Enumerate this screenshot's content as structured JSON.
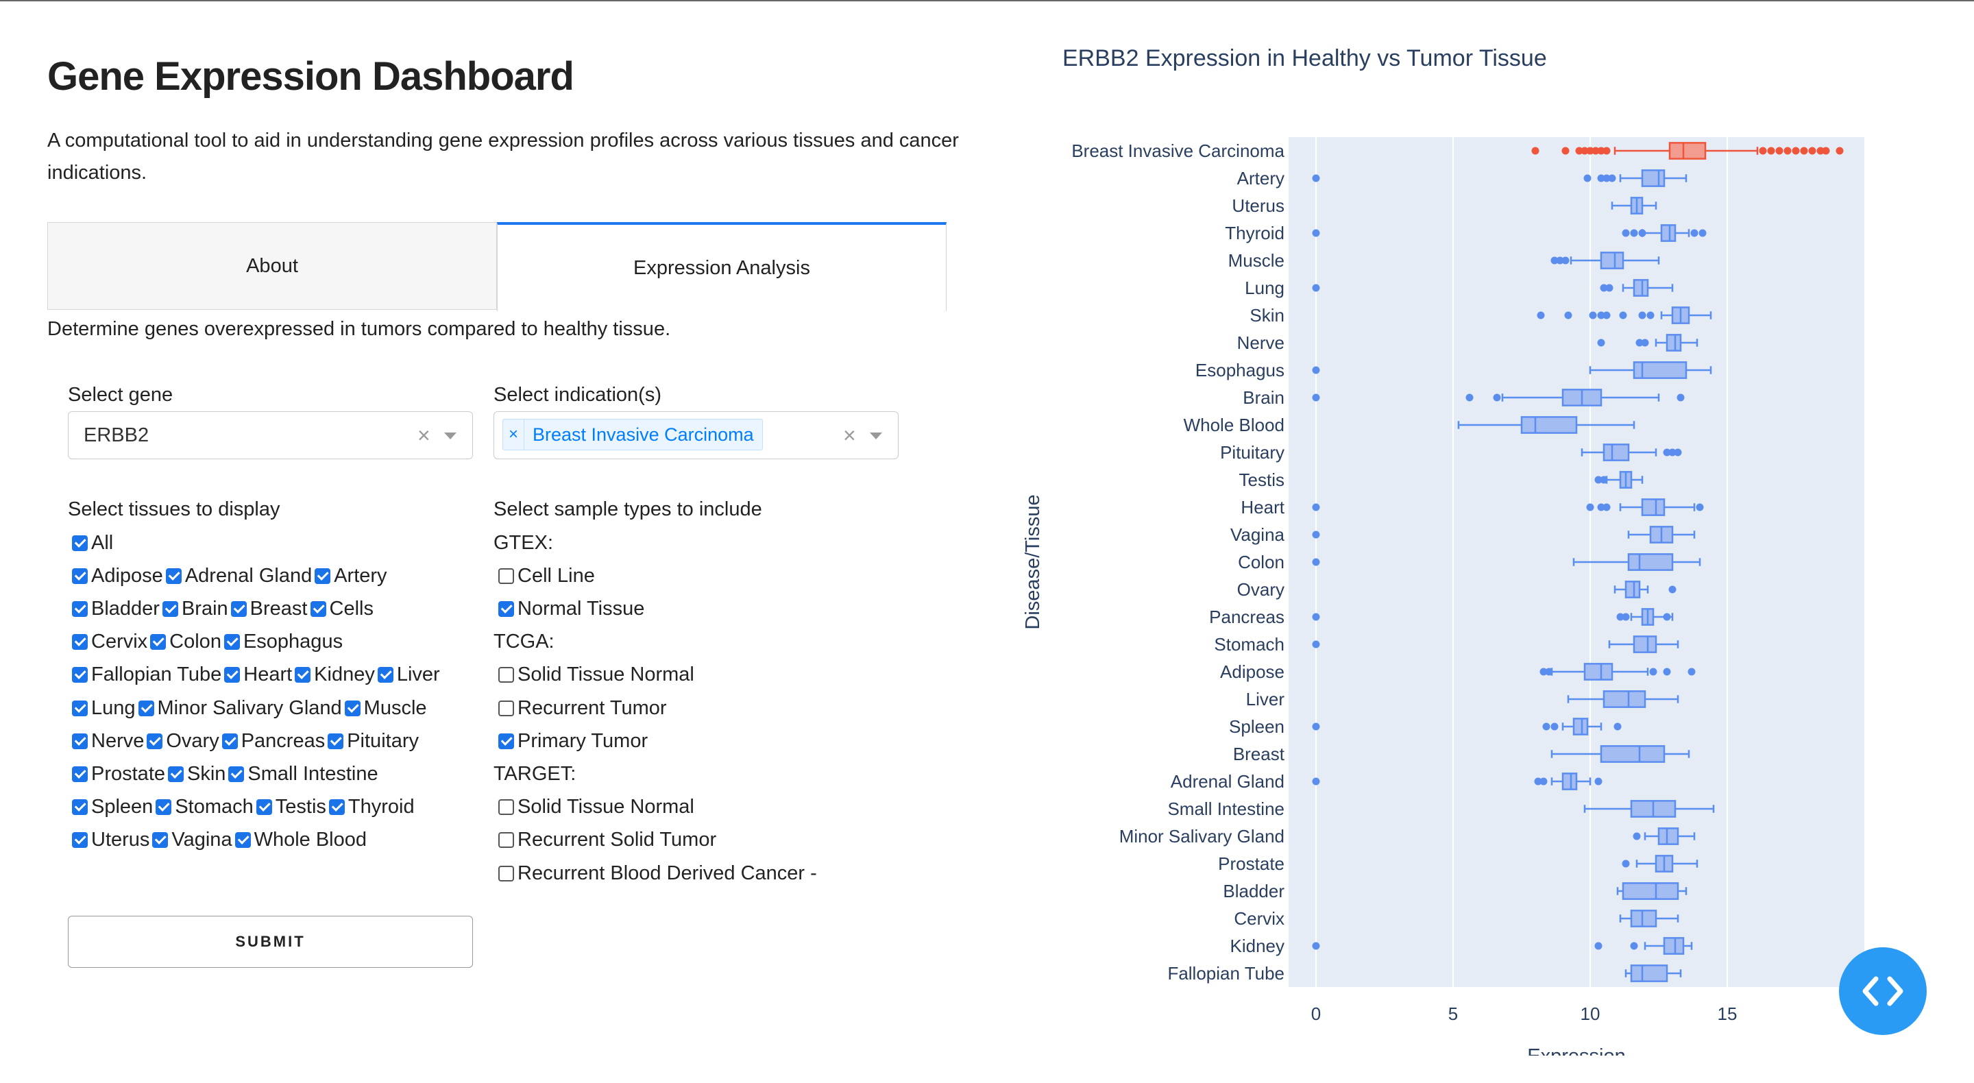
{
  "header": {
    "title": "Gene Expression Dashboard",
    "description": "A computational tool to aid in understanding gene expression profiles across various tissues and cancer indications."
  },
  "tabs": [
    {
      "label": "About",
      "active": false
    },
    {
      "label": "Expression Analysis",
      "active": true
    }
  ],
  "analysis": {
    "subtitle": "Determine genes overexpressed in tumors compared to healthy tissue.",
    "gene_label": "Select gene",
    "gene_value": "ERBB2",
    "indication_label": "Select indication(s)",
    "indication_values": [
      "Breast Invasive Carcinoma"
    ],
    "tissues_label": "Select tissues to display",
    "tissue_rows": [
      [
        {
          "label": "All",
          "checked": true
        }
      ],
      [
        {
          "label": "Adipose",
          "checked": true
        },
        {
          "label": "Adrenal Gland",
          "checked": true
        },
        {
          "label": "Artery",
          "checked": true
        }
      ],
      [
        {
          "label": "Bladder",
          "checked": true
        },
        {
          "label": "Brain",
          "checked": true
        },
        {
          "label": "Breast",
          "checked": true
        },
        {
          "label": "Cells",
          "checked": true
        }
      ],
      [
        {
          "label": "Cervix",
          "checked": true
        },
        {
          "label": "Colon",
          "checked": true
        },
        {
          "label": "Esophagus",
          "checked": true
        }
      ],
      [
        {
          "label": "Fallopian Tube",
          "checked": true
        },
        {
          "label": "Heart",
          "checked": true
        },
        {
          "label": "Kidney",
          "checked": true
        },
        {
          "label": "Liver",
          "checked": true
        }
      ],
      [
        {
          "label": "Lung",
          "checked": true
        },
        {
          "label": "Minor Salivary Gland",
          "checked": true
        },
        {
          "label": "Muscle",
          "checked": true
        }
      ],
      [
        {
          "label": "Nerve",
          "checked": true
        },
        {
          "label": "Ovary",
          "checked": true
        },
        {
          "label": "Pancreas",
          "checked": true
        },
        {
          "label": "Pituitary",
          "checked": true
        }
      ],
      [
        {
          "label": "Prostate",
          "checked": true
        },
        {
          "label": "Skin",
          "checked": true
        },
        {
          "label": "Small Intestine",
          "checked": true
        }
      ],
      [
        {
          "label": "Spleen",
          "checked": true
        },
        {
          "label": "Stomach",
          "checked": true
        },
        {
          "label": "Testis",
          "checked": true
        },
        {
          "label": "Thyroid",
          "checked": true
        }
      ],
      [
        {
          "label": "Uterus",
          "checked": true
        },
        {
          "label": "Vagina",
          "checked": true
        },
        {
          "label": "Whole Blood",
          "checked": true
        }
      ]
    ],
    "samples_label": "Select sample types to include",
    "sample_groups": [
      {
        "name": "GTEX:",
        "options": [
          {
            "label": "Cell Line",
            "checked": false
          },
          {
            "label": "Normal Tissue",
            "checked": true
          }
        ]
      },
      {
        "name": "TCGA:",
        "options": [
          {
            "label": "Solid Tissue Normal",
            "checked": false
          },
          {
            "label": "Recurrent Tumor",
            "checked": false
          },
          {
            "label": "Primary Tumor",
            "checked": true
          }
        ]
      },
      {
        "name": "TARGET:",
        "options": [
          {
            "label": "Solid Tissue Normal",
            "checked": false
          },
          {
            "label": "Recurrent Solid Tumor",
            "checked": false
          },
          {
            "label": "Recurrent Blood Derived Cancer -",
            "checked": false
          }
        ]
      }
    ],
    "submit_label": "SUBMIT"
  },
  "chart_data": {
    "type": "box",
    "orientation": "horizontal",
    "title": "ERBB2 Expression in Healthy vs Tumor Tissue",
    "xlabel": "Expression",
    "ylabel": "Disease/Tissue",
    "xlim": [
      -1,
      20
    ],
    "xticks": [
      0,
      5,
      10,
      15
    ],
    "grid": true,
    "colors": {
      "tumor": "#ef553b",
      "normal": "#636efa",
      "plot_bg": "#e5ecf6",
      "box_fill": "#a3bdf3",
      "normal_line": "#5b8def"
    },
    "categories": [
      {
        "label": "Breast Invasive Carcinoma",
        "tumor": true,
        "q1": 12.9,
        "median": 13.4,
        "q3": 14.2,
        "lo": 10.9,
        "hi": 16.1,
        "outliers": [
          8.0,
          9.1,
          9.6,
          9.8,
          10.0,
          10.2,
          10.4,
          10.6,
          16.3,
          16.6,
          16.9,
          17.2,
          17.5,
          17.8,
          18.1,
          18.4,
          18.6,
          19.1
        ]
      },
      {
        "label": "Artery",
        "q1": 11.9,
        "median": 12.5,
        "q3": 12.7,
        "lo": 11.1,
        "hi": 13.5,
        "outliers": [
          0,
          9.9,
          10.4,
          10.6,
          10.8
        ]
      },
      {
        "label": "Uterus",
        "q1": 11.5,
        "median": 11.7,
        "q3": 11.9,
        "lo": 10.8,
        "hi": 12.4,
        "outliers": []
      },
      {
        "label": "Thyroid",
        "q1": 12.6,
        "median": 12.9,
        "q3": 13.1,
        "lo": 11.9,
        "hi": 13.6,
        "outliers": [
          0,
          11.3,
          11.6,
          11.9,
          13.8,
          14.1
        ]
      },
      {
        "label": "Muscle",
        "q1": 10.4,
        "median": 10.9,
        "q3": 11.2,
        "lo": 9.3,
        "hi": 12.5,
        "outliers": [
          8.7,
          8.9,
          9.1
        ]
      },
      {
        "label": "Lung",
        "q1": 11.6,
        "median": 11.9,
        "q3": 12.1,
        "lo": 11.2,
        "hi": 13.0,
        "outliers": [
          0,
          10.5,
          10.7
        ]
      },
      {
        "label": "Skin",
        "q1": 13.0,
        "median": 13.3,
        "q3": 13.6,
        "lo": 12.6,
        "hi": 14.4,
        "outliers": [
          8.2,
          9.2,
          10.1,
          10.4,
          10.6,
          11.2,
          11.9,
          12.2
        ]
      },
      {
        "label": "Nerve",
        "q1": 12.8,
        "median": 13.1,
        "q3": 13.3,
        "lo": 12.4,
        "hi": 13.9,
        "outliers": [
          10.4,
          11.8,
          12.0
        ]
      },
      {
        "label": "Esophagus",
        "q1": 11.6,
        "median": 11.9,
        "q3": 13.5,
        "lo": 10.0,
        "hi": 14.4,
        "outliers": [
          0
        ]
      },
      {
        "label": "Brain",
        "q1": 9.0,
        "median": 9.7,
        "q3": 10.4,
        "lo": 6.8,
        "hi": 12.5,
        "outliers": [
          0,
          5.6,
          6.6,
          13.3
        ]
      },
      {
        "label": "Whole Blood",
        "q1": 7.5,
        "median": 8.0,
        "q3": 9.5,
        "lo": 5.2,
        "hi": 11.6,
        "outliers": []
      },
      {
        "label": "Pituitary",
        "q1": 10.5,
        "median": 10.8,
        "q3": 11.4,
        "lo": 9.7,
        "hi": 12.4,
        "outliers": [
          12.8,
          13.0,
          13.2
        ]
      },
      {
        "label": "Testis",
        "q1": 11.1,
        "median": 11.3,
        "q3": 11.5,
        "lo": 10.6,
        "hi": 11.9,
        "outliers": [
          10.3,
          10.5
        ]
      },
      {
        "label": "Heart",
        "q1": 11.9,
        "median": 12.4,
        "q3": 12.7,
        "lo": 11.1,
        "hi": 13.8,
        "outliers": [
          0,
          10.0,
          10.4,
          10.6,
          14.0
        ]
      },
      {
        "label": "Vagina",
        "q1": 12.2,
        "median": 12.6,
        "q3": 13.0,
        "lo": 11.4,
        "hi": 13.8,
        "outliers": [
          0
        ]
      },
      {
        "label": "Colon",
        "q1": 11.4,
        "median": 11.8,
        "q3": 13.0,
        "lo": 9.4,
        "hi": 14.0,
        "outliers": [
          0
        ]
      },
      {
        "label": "Ovary",
        "q1": 11.3,
        "median": 11.6,
        "q3": 11.8,
        "lo": 10.9,
        "hi": 12.1,
        "outliers": [
          13.0
        ]
      },
      {
        "label": "Pancreas",
        "q1": 11.9,
        "median": 12.1,
        "q3": 12.3,
        "lo": 11.5,
        "hi": 13.0,
        "outliers": [
          0,
          11.1,
          11.3,
          12.8
        ]
      },
      {
        "label": "Stomach",
        "q1": 11.6,
        "median": 12.1,
        "q3": 12.4,
        "lo": 10.7,
        "hi": 13.2,
        "outliers": [
          0
        ]
      },
      {
        "label": "Adipose",
        "q1": 9.8,
        "median": 10.4,
        "q3": 10.8,
        "lo": 8.6,
        "hi": 12.1,
        "outliers": [
          8.3,
          8.5,
          12.3,
          12.8,
          13.7
        ]
      },
      {
        "label": "Liver",
        "q1": 10.5,
        "median": 11.4,
        "q3": 12.0,
        "lo": 9.2,
        "hi": 13.2,
        "outliers": []
      },
      {
        "label": "Spleen",
        "q1": 9.4,
        "median": 9.7,
        "q3": 9.9,
        "lo": 9.0,
        "hi": 10.4,
        "outliers": [
          0,
          8.4,
          8.7,
          11.0
        ]
      },
      {
        "label": "Breast",
        "q1": 10.4,
        "median": 11.8,
        "q3": 12.7,
        "lo": 8.6,
        "hi": 13.6,
        "outliers": []
      },
      {
        "label": "Adrenal Gland",
        "q1": 9.0,
        "median": 9.3,
        "q3": 9.5,
        "lo": 8.6,
        "hi": 10.0,
        "outliers": [
          0,
          8.1,
          8.3,
          10.3
        ]
      },
      {
        "label": "Small Intestine",
        "q1": 11.5,
        "median": 12.3,
        "q3": 13.1,
        "lo": 9.8,
        "hi": 14.5,
        "outliers": []
      },
      {
        "label": "Minor Salivary Gland",
        "q1": 12.5,
        "median": 12.8,
        "q3": 13.2,
        "lo": 12.0,
        "hi": 13.8,
        "outliers": [
          11.7
        ]
      },
      {
        "label": "Prostate",
        "q1": 12.4,
        "median": 12.7,
        "q3": 13.0,
        "lo": 11.7,
        "hi": 13.9,
        "outliers": [
          11.3
        ]
      },
      {
        "label": "Bladder",
        "q1": 11.2,
        "median": 12.4,
        "q3": 13.2,
        "lo": 11.0,
        "hi": 13.5,
        "outliers": []
      },
      {
        "label": "Cervix",
        "q1": 11.5,
        "median": 11.9,
        "q3": 12.4,
        "lo": 11.1,
        "hi": 13.2,
        "outliers": []
      },
      {
        "label": "Kidney",
        "q1": 12.7,
        "median": 13.1,
        "q3": 13.4,
        "lo": 12.0,
        "hi": 13.7,
        "outliers": [
          0,
          10.3,
          11.6
        ]
      },
      {
        "label": "Fallopian Tube",
        "q1": 11.5,
        "median": 11.9,
        "q3": 12.8,
        "lo": 11.3,
        "hi": 13.3,
        "outliers": []
      }
    ]
  },
  "fab": {
    "icon": "code-icon"
  }
}
